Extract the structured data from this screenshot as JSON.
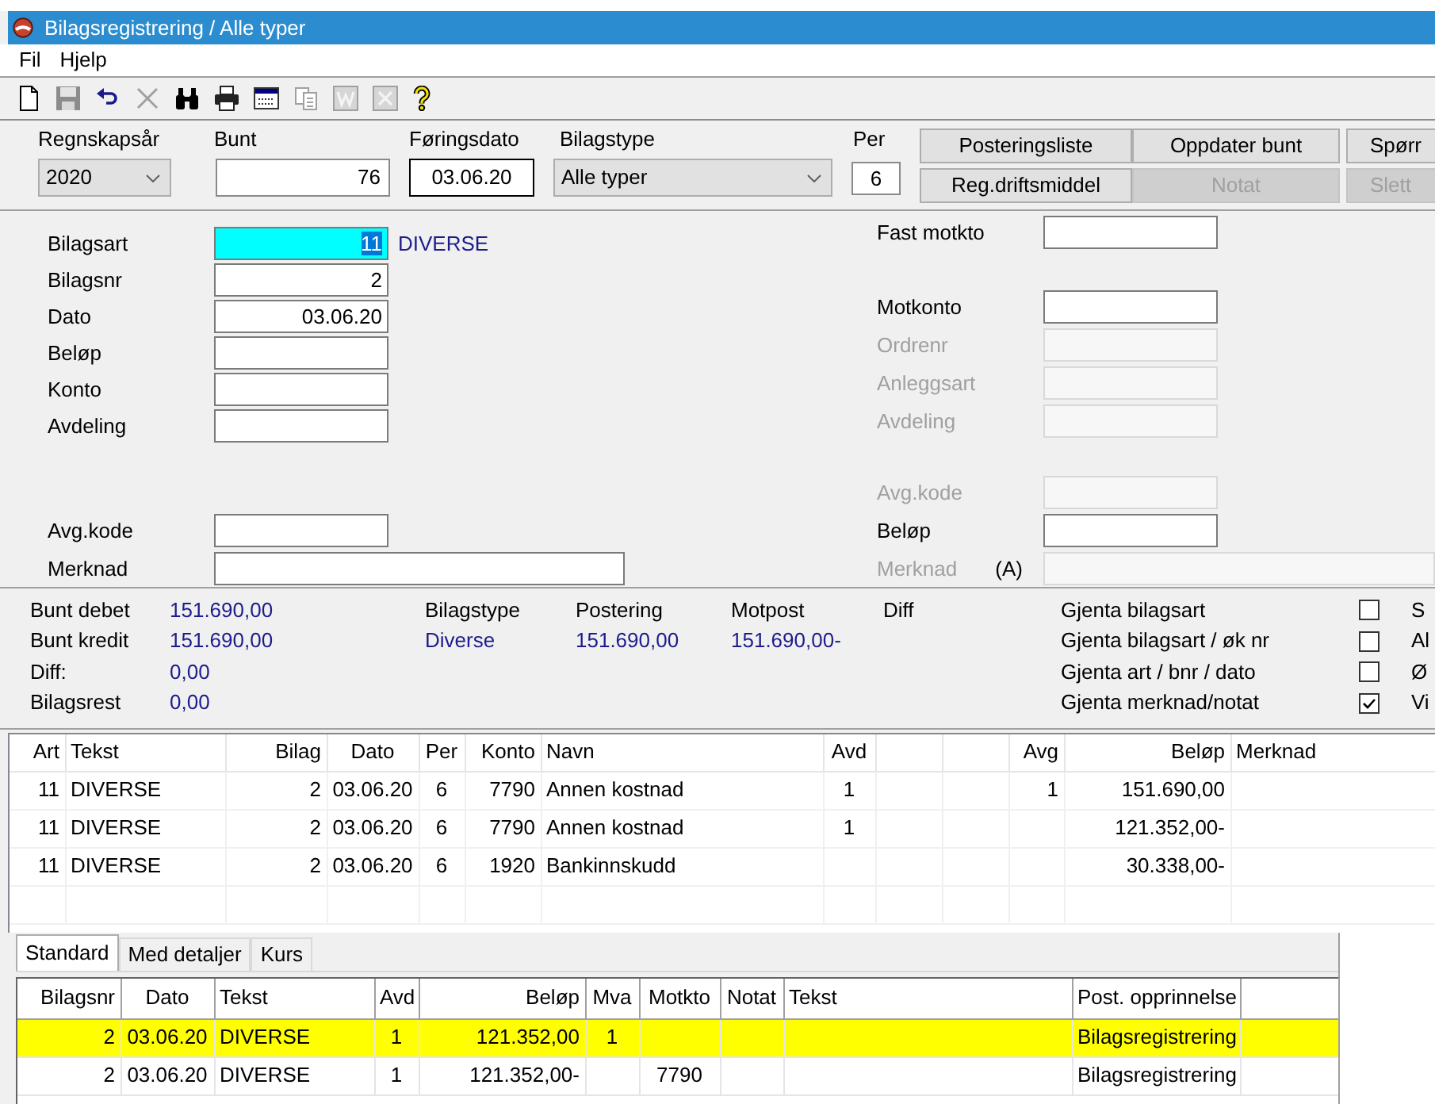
{
  "window": {
    "title": "Bilagsregistrering / Alle typer"
  },
  "menu": [
    "Fil",
    "Hjelp"
  ],
  "toolbar": [
    {
      "kind": "new",
      "disabled": false
    },
    {
      "kind": "save",
      "disabled": true
    },
    {
      "kind": "undo",
      "disabled": false
    },
    {
      "kind": "delete",
      "disabled": true
    },
    {
      "kind": "find",
      "disabled": false
    },
    {
      "kind": "print",
      "disabled": false
    },
    {
      "kind": "window",
      "disabled": false
    },
    {
      "kind": "copy",
      "disabled": true
    },
    {
      "kind": "word",
      "disabled": true
    },
    {
      "kind": "excel",
      "disabled": true
    },
    {
      "kind": "help",
      "disabled": false
    }
  ],
  "header": {
    "fields": [
      {
        "label": "Regnskapsår",
        "kind": "combo",
        "value": "2020"
      },
      {
        "label": "Bunt",
        "kind": "text",
        "value": "76"
      },
      {
        "label": "Føringsdato",
        "kind": "text",
        "value": "03.06.20"
      },
      {
        "label": "Bilagstype",
        "kind": "combo",
        "value": "Alle typer"
      },
      {
        "label": "Per",
        "kind": "text",
        "value": "6"
      }
    ],
    "buttons": [
      {
        "label": "Posteringsliste",
        "disabled": false
      },
      {
        "label": "Oppdater bunt",
        "disabled": false
      },
      {
        "label": "Spørr",
        "disabled": false
      },
      {
        "label": "Reg.driftsmiddel",
        "disabled": false
      },
      {
        "label": "Notat",
        "disabled": true
      },
      {
        "label": "Slett",
        "disabled": true
      }
    ]
  },
  "entry_form": {
    "left_groups": [
      {
        "fields": [
          {
            "label": "Bilagsart",
            "value": "11",
            "description": "DIVERSE",
            "focused": true,
            "kind": "short"
          },
          {
            "label": "Bilagsnr",
            "value": "2",
            "focused": false,
            "kind": "short"
          },
          {
            "label": "Dato",
            "value": "03.06.20",
            "focused": false,
            "kind": "short"
          },
          {
            "label": "Beløp",
            "focused": false,
            "kind": "short"
          },
          {
            "label": "Konto",
            "focused": false,
            "kind": "short"
          },
          {
            "label": "Avdeling",
            "focused": false,
            "kind": "short"
          }
        ]
      },
      {
        "fields": [
          {
            "label": "Avg.kode",
            "focused": false,
            "kind": "short"
          },
          {
            "label": "Merknad",
            "focused": false,
            "kind": "long"
          }
        ]
      }
    ],
    "right_groups": [
      {
        "fields": [
          {
            "label": "Fast motkto",
            "disabled": false,
            "kind": "short"
          }
        ]
      },
      {
        "fields": [
          {
            "label": "Motkonto",
            "disabled": false,
            "kind": "short"
          },
          {
            "label": "Ordrenr",
            "disabled": true,
            "kind": "short"
          },
          {
            "label": "Anleggsart",
            "disabled": true,
            "kind": "short"
          },
          {
            "label": "Avdeling",
            "disabled": true,
            "kind": "short"
          }
        ]
      },
      {
        "fields": [
          {
            "label": "Avg.kode",
            "disabled": true,
            "kind": "short"
          },
          {
            "label": "Beløp",
            "disabled": false,
            "kind": "short"
          },
          {
            "label": "Merknad",
            "note": "(A)",
            "disabled": true,
            "kind": "long"
          }
        ]
      }
    ]
  },
  "totals": [
    {
      "label": "Bunt debet",
      "value": "151.690,00"
    },
    {
      "label": "Bunt kredit",
      "value": "151.690,00"
    },
    {
      "label": "Diff:",
      "value": "0,00"
    },
    {
      "label": "Bilagsrest",
      "value": "0,00"
    }
  ],
  "posting_summary": {
    "headings": [
      "Bilagstype",
      "Postering",
      "Motpost",
      "Diff"
    ],
    "values": [
      "Diverse",
      "151.690,00",
      "151.690,00-"
    ]
  },
  "repeat_options": [
    {
      "label": "Gjenta bilagsart",
      "checked": false
    },
    {
      "label": "Gjenta bilagsart / øk nr",
      "checked": false
    },
    {
      "label": "Gjenta art / bnr / dato",
      "checked": false
    },
    {
      "label": "Gjenta merknad/notat",
      "checked": true
    }
  ],
  "next_options": [
    "S",
    "Al",
    "Ø",
    "Vi"
  ],
  "entries_table": {
    "columns": [
      "Art",
      "Tekst",
      "Bilag",
      "Dato",
      "Per",
      "Konto",
      "Navn",
      "Avd",
      null,
      null,
      "Avg",
      "Beløp",
      "Merknad"
    ],
    "rows": [
      [
        "11",
        "DIVERSE",
        "2",
        "03.06.20",
        "6",
        "7790",
        "Annen kostnad",
        "1",
        null,
        null,
        "1",
        "151.690,00",
        null
      ],
      [
        "11",
        "DIVERSE",
        "2",
        "03.06.20",
        "6",
        "7790",
        "Annen kostnad",
        "1",
        null,
        null,
        null,
        "121.352,00-",
        null
      ],
      [
        "11",
        "DIVERSE",
        "2",
        "03.06.20",
        "6",
        "1920",
        "Bankinnskudd",
        null,
        null,
        null,
        null,
        "30.338,00-",
        null
      ]
    ]
  },
  "detail_tabs": [
    {
      "label": "Standard",
      "selected": true
    },
    {
      "label": "Med detaljer",
      "selected": false
    },
    {
      "label": "Kurs",
      "selected": false
    }
  ],
  "detail_table": {
    "columns": [
      "Bilagsnr",
      "Dato",
      "Tekst",
      "Avd",
      "Beløp",
      "Mva",
      "Motkto",
      "Notat",
      "Tekst",
      "Post. opprinnelse",
      null
    ],
    "rows": [
      {
        "selected": true,
        "cells": [
          "2",
          "03.06.20",
          "DIVERSE",
          "1",
          "121.352,00",
          "1",
          null,
          null,
          null,
          "Bilagsregistrering",
          null
        ]
      },
      {
        "selected": false,
        "cells": [
          "2",
          "03.06.20",
          "DIVERSE",
          "1",
          "121.352,00-",
          null,
          "7790",
          null,
          null,
          "Bilagsregistrering",
          null
        ]
      }
    ]
  }
}
